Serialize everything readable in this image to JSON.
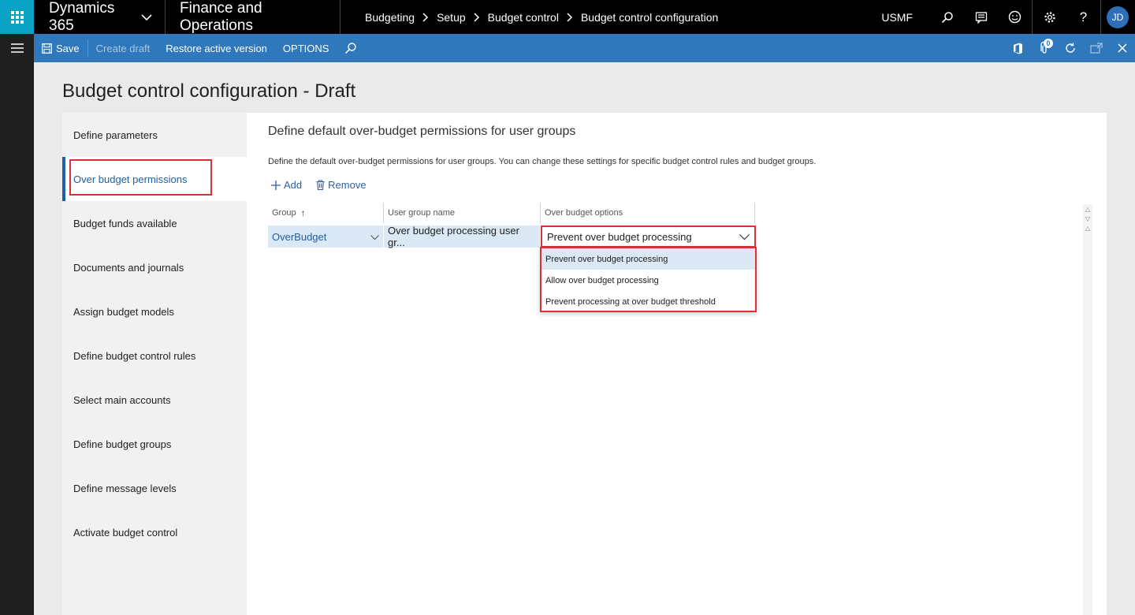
{
  "topbar": {
    "app_name": "Dynamics 365",
    "module_name": "Finance and Operations",
    "breadcrumbs": [
      "Budgeting",
      "Setup",
      "Budget control",
      "Budget control configuration"
    ],
    "company": "USMF",
    "user_initials": "JD"
  },
  "actionbar": {
    "save": "Save",
    "create_draft": "Create draft",
    "restore": "Restore active version",
    "options": "OPTIONS",
    "attachment_count": "0"
  },
  "page": {
    "title": "Budget control configuration - Draft"
  },
  "steps": [
    {
      "label": "Define parameters"
    },
    {
      "label": "Over budget permissions",
      "active": true
    },
    {
      "label": "Budget funds available"
    },
    {
      "label": "Documents and journals"
    },
    {
      "label": "Assign budget models"
    },
    {
      "label": "Define budget control rules"
    },
    {
      "label": "Select main accounts"
    },
    {
      "label": "Define budget groups"
    },
    {
      "label": "Define message levels"
    },
    {
      "label": "Activate budget control"
    }
  ],
  "section": {
    "title": "Define default over-budget permissions for user groups",
    "description": "Define the default over-budget permissions for user groups. You can change these settings for specific budget control rules and budget groups.",
    "add": "Add",
    "remove": "Remove"
  },
  "grid": {
    "columns": [
      "Group",
      "User group name",
      "Over budget options"
    ],
    "sort_indicator": "↑",
    "row": {
      "group": "OverBudget",
      "user_group_name": "Over budget processing user gr...",
      "option": "Prevent over budget processing"
    }
  },
  "dropdown": {
    "options": [
      "Prevent over budget processing",
      "Allow over budget processing",
      "Prevent processing at over budget threshold"
    ],
    "selected_index": 0
  },
  "colors": {
    "accent": "#2f78bb",
    "waffle": "#0ba3c5",
    "highlight": "#d6323a",
    "selected_row": "#dbe8f5"
  }
}
